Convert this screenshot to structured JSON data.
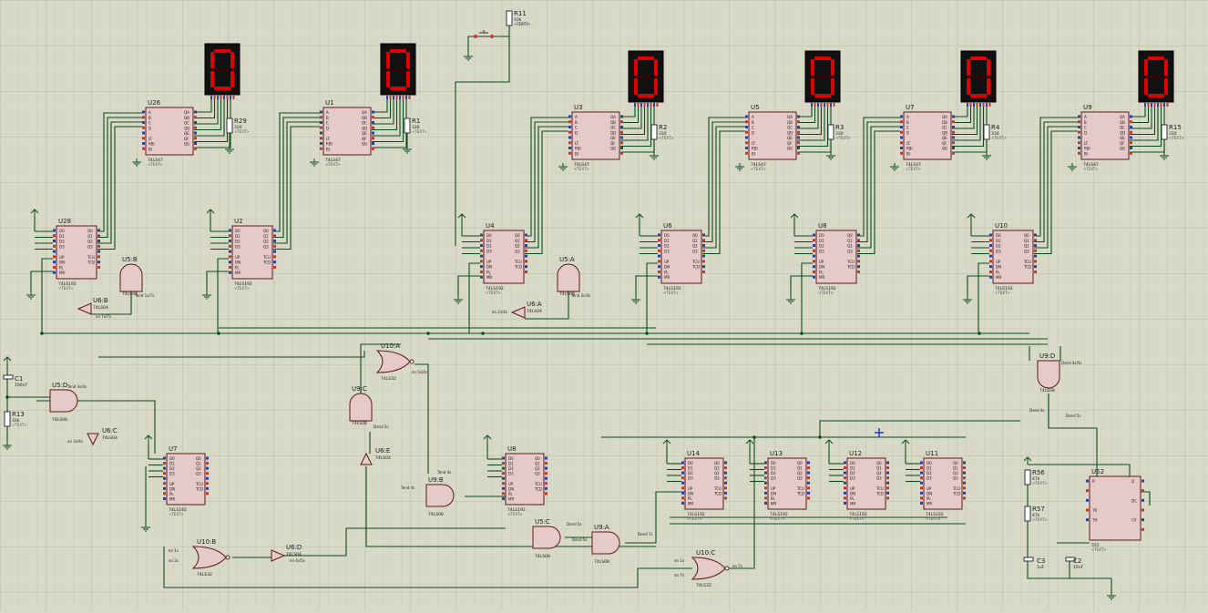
{
  "schematic": {
    "displays": [
      {
        "id": "seg-1",
        "digit": "0"
      },
      {
        "id": "seg-2",
        "digit": "0"
      },
      {
        "id": "seg-3",
        "digit": "0"
      },
      {
        "id": "seg-4",
        "digit": "0"
      },
      {
        "id": "seg-5",
        "digit": "0"
      },
      {
        "id": "seg-6",
        "digit": "0"
      }
    ],
    "decoders": [
      {
        "ref": "U26",
        "part": "74LS47"
      },
      {
        "ref": "U1",
        "part": "74LS47"
      },
      {
        "ref": "U3",
        "part": "74LS47"
      },
      {
        "ref": "U5",
        "part": "74LS47"
      },
      {
        "ref": "U7",
        "part": "74LS47"
      },
      {
        "ref": "U9",
        "part": "74LS47"
      }
    ],
    "counters_top": [
      {
        "ref": "U28",
        "part": "74LS192"
      },
      {
        "ref": "U2",
        "part": "74LS192"
      },
      {
        "ref": "U4",
        "part": "74LS192"
      },
      {
        "ref": "U6",
        "part": "74LS192"
      },
      {
        "ref": "U8",
        "part": "74LS192"
      },
      {
        "ref": "U10",
        "part": "74LS192"
      }
    ],
    "counters_bottom": [
      {
        "ref": "U7",
        "part": "74LS192"
      },
      {
        "ref": "U8",
        "part": "74LS192"
      },
      {
        "ref": "U14",
        "part": "74LS192"
      },
      {
        "ref": "U13",
        "part": "74LS192"
      },
      {
        "ref": "U12",
        "part": "74LS192"
      },
      {
        "ref": "U11",
        "part": "74LS192"
      }
    ],
    "resistors_top": [
      "R29",
      "R1",
      "R2",
      "R3",
      "R4",
      "R15"
    ],
    "resistor_value": "330",
    "text_placeholder": "<TEXT>",
    "gates": [
      {
        "ref": "U5:B",
        "part": "74LS08"
      },
      {
        "ref": "U6:B",
        "part": "74LS04"
      },
      {
        "ref": "U5:A",
        "part": "74LS08"
      },
      {
        "ref": "U6:A",
        "part": "74LS04"
      },
      {
        "ref": "U10:A",
        "part": "74LS32"
      },
      {
        "ref": "U9:C",
        "part": "74LS08"
      },
      {
        "ref": "U5:D",
        "part": "74LS08"
      },
      {
        "ref": "U6:C",
        "part": "74LS04"
      },
      {
        "ref": "U6:E",
        "part": "74LS04"
      },
      {
        "ref": "U9:B",
        "part": "74LS08"
      },
      {
        "ref": "U5:C",
        "part": "74LS08"
      },
      {
        "ref": "U9:A",
        "part": "74LS08"
      },
      {
        "ref": "U10:B",
        "part": "74LS32"
      },
      {
        "ref": "U6:D",
        "part": "74LS04"
      },
      {
        "ref": "U10:C",
        "part": "74LS32"
      },
      {
        "ref": "U9:D",
        "part": "74LS08"
      }
    ],
    "passives": [
      {
        "ref": "R11",
        "value": "10k"
      },
      {
        "ref": "C1",
        "value": "100nF"
      },
      {
        "ref": "R13",
        "value": "10k"
      },
      {
        "ref": "R56",
        "value": "47k"
      },
      {
        "ref": "R57",
        "value": "47k"
      },
      {
        "ref": "C3",
        "value": "1uF"
      },
      {
        "ref": "C2",
        "value": "10nF"
      },
      {
        "ref": "U52",
        "value": "555"
      }
    ]
  }
}
